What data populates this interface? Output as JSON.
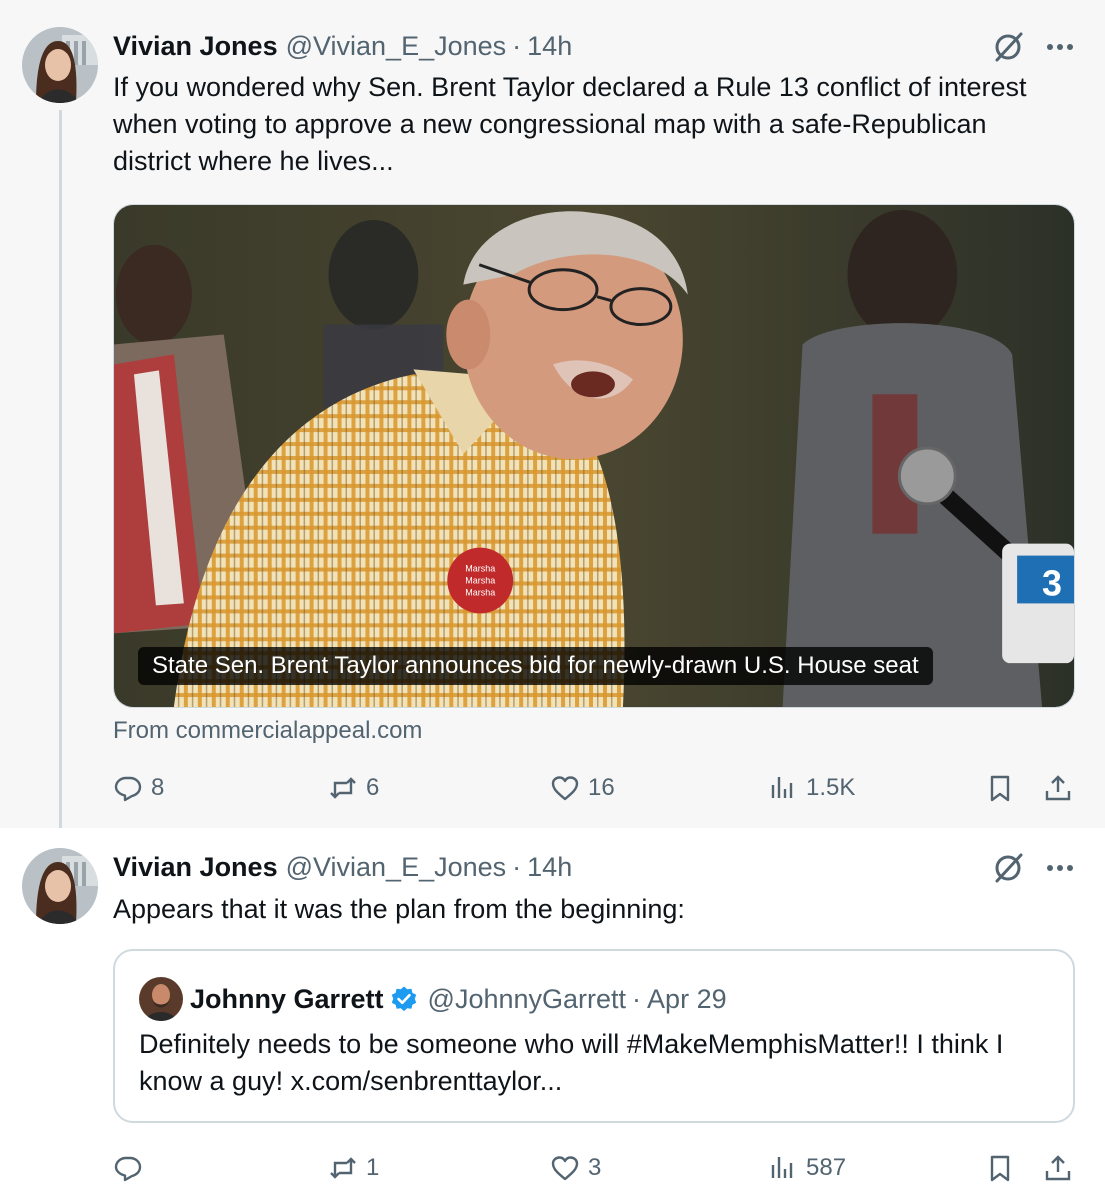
{
  "tweets": [
    {
      "author": {
        "name": "Vivian Jones",
        "handle": "@Vivian_E_Jones"
      },
      "separator": "·",
      "time": "14h",
      "text": "If you wondered why Sen. Brent Taylor declared a Rule 13 conflict of interest when voting to approve a new congressional map with a safe-Republican district where he lives...",
      "media": {
        "caption": "State Sen. Brent Taylor announces bid for newly-drawn U.S. House seat",
        "source": "From commercialappeal.com"
      },
      "actions": {
        "replies": "8",
        "reposts": "6",
        "likes": "16",
        "views": "1.5K"
      }
    },
    {
      "author": {
        "name": "Vivian Jones",
        "handle": "@Vivian_E_Jones"
      },
      "separator": "·",
      "time": "14h",
      "text": "Appears that it was the plan from the beginning:",
      "quote": {
        "author": {
          "name": "Johnny Garrett",
          "handle": "@JohnnyGarrett"
        },
        "separator": "·",
        "time": "Apr 29",
        "text": "Definitely needs to be someone who will #MakeMemphisMatter!!  I think I know a guy! x.com/senbrenttaylor..."
      },
      "actions": {
        "replies": "",
        "reposts": "1",
        "likes": "3",
        "views": "587"
      }
    }
  ],
  "icons": {
    "reply": "speech-bubble-icon",
    "repost": "repost-arrows-icon",
    "like": "heart-icon",
    "views": "bar-chart-icon",
    "bookmark": "bookmark-icon",
    "share": "share-upload-icon",
    "grok": "grok-slash-circle-icon",
    "more": "ellipsis-icon",
    "verified": "verified-badge-icon"
  },
  "colors": {
    "text": "#0f1419",
    "secondary": "#536471",
    "border": "#cfd9de",
    "verified": "#1d9bf0",
    "tweet1_background": "#f7f7f7"
  }
}
